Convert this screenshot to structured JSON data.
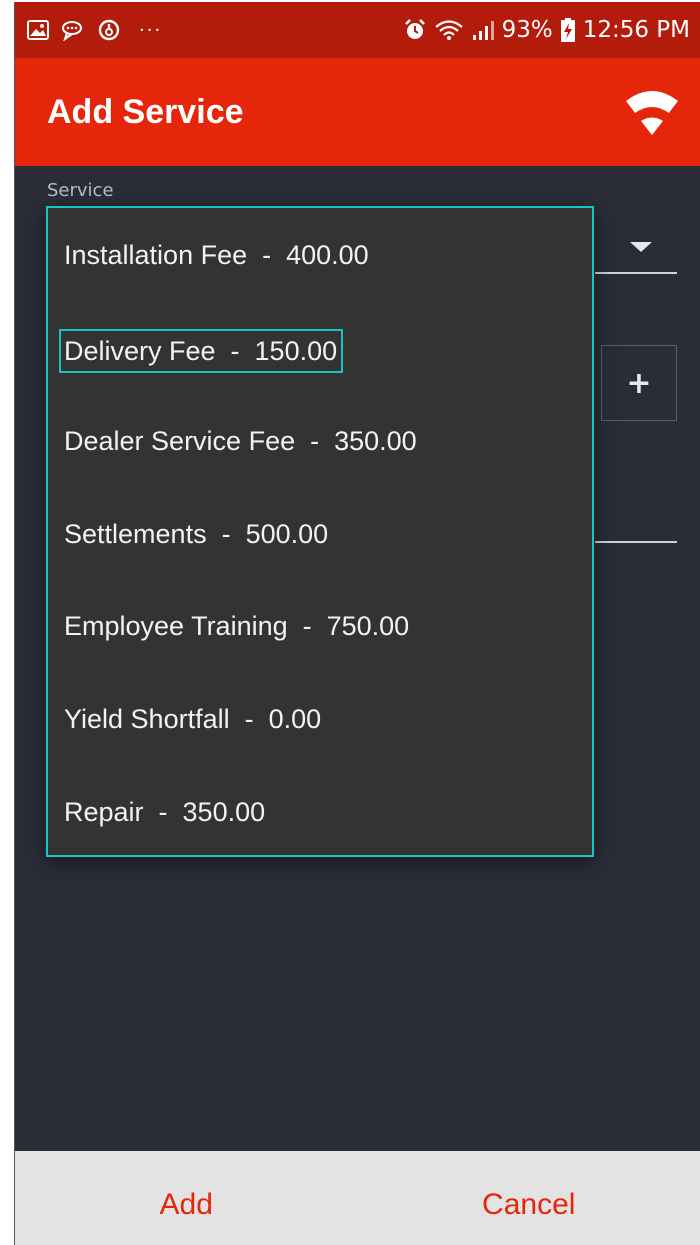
{
  "status_bar": {
    "battery": "93%",
    "time": "12:56 PM",
    "dots": "···",
    "left_icons": [
      "image-icon",
      "chat-icon",
      "sync-icon"
    ],
    "right_icons": [
      "alarm-icon",
      "wifi-icon",
      "signal-icon",
      "battery-charging-icon"
    ]
  },
  "app_bar": {
    "title": "Add Service",
    "action_icon": "wifi-icon"
  },
  "form": {
    "service_label": "Service",
    "stepper_plus": "+"
  },
  "popup": {
    "items": [
      {
        "label": "Installation Fee  -  400.00"
      },
      {
        "label": "Delivery Fee  -  150.00"
      },
      {
        "label": "Dealer Service Fee  -  350.00"
      },
      {
        "label": "Settlements  -  500.00"
      },
      {
        "label": "Employee Training  -  750.00"
      },
      {
        "label": "Yield Shortfall  -  0.00"
      },
      {
        "label": "Repair  -  350.00"
      }
    ],
    "highlighted_index": 1
  },
  "buttons": {
    "add": "Add",
    "cancel": "Cancel"
  },
  "colors": {
    "status_bar": "#b31b0a",
    "app_bar": "#e5260a",
    "background": "#2a2d37",
    "popup": "#333333",
    "accent_outline": "#19c4c4",
    "button_text": "#e5260a",
    "bottom_bar": "#e3e3e3"
  }
}
